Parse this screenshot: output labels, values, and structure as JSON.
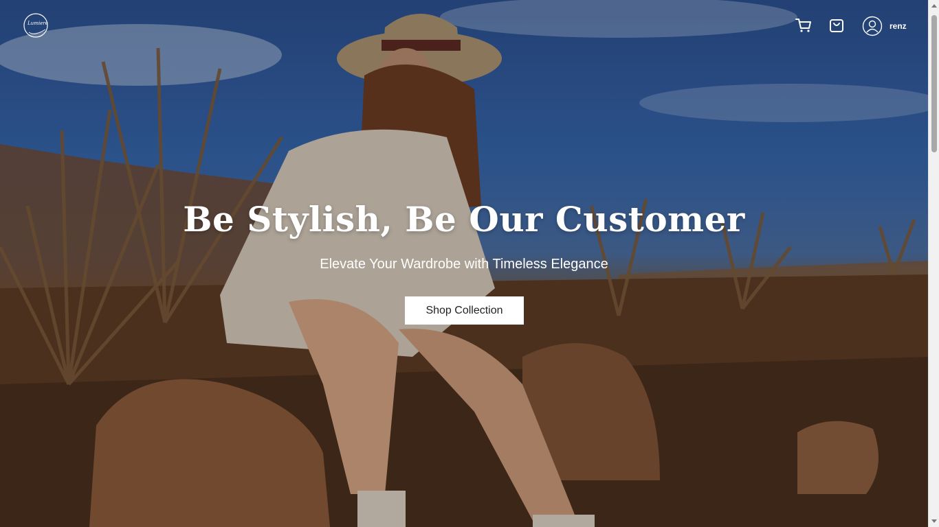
{
  "brand": {
    "logo_text": "Lumiere",
    "logo_icon": "circle-script-logo-icon"
  },
  "header": {
    "cart_icon": "shopping-cart-icon",
    "bag_icon": "shopping-bag-icon",
    "avatar_icon": "user-avatar-icon",
    "username": "renz"
  },
  "hero": {
    "title": "Be Stylish, Be Our Customer",
    "subtitle": "Elevate Your Wardrobe with Timeless Elegance",
    "cta_label": "Shop Collection"
  },
  "colors": {
    "text": "#ffffff",
    "button_bg": "#ffffff",
    "button_text": "#222222",
    "sky": "#3564a9",
    "ground": "#5a3a24"
  }
}
